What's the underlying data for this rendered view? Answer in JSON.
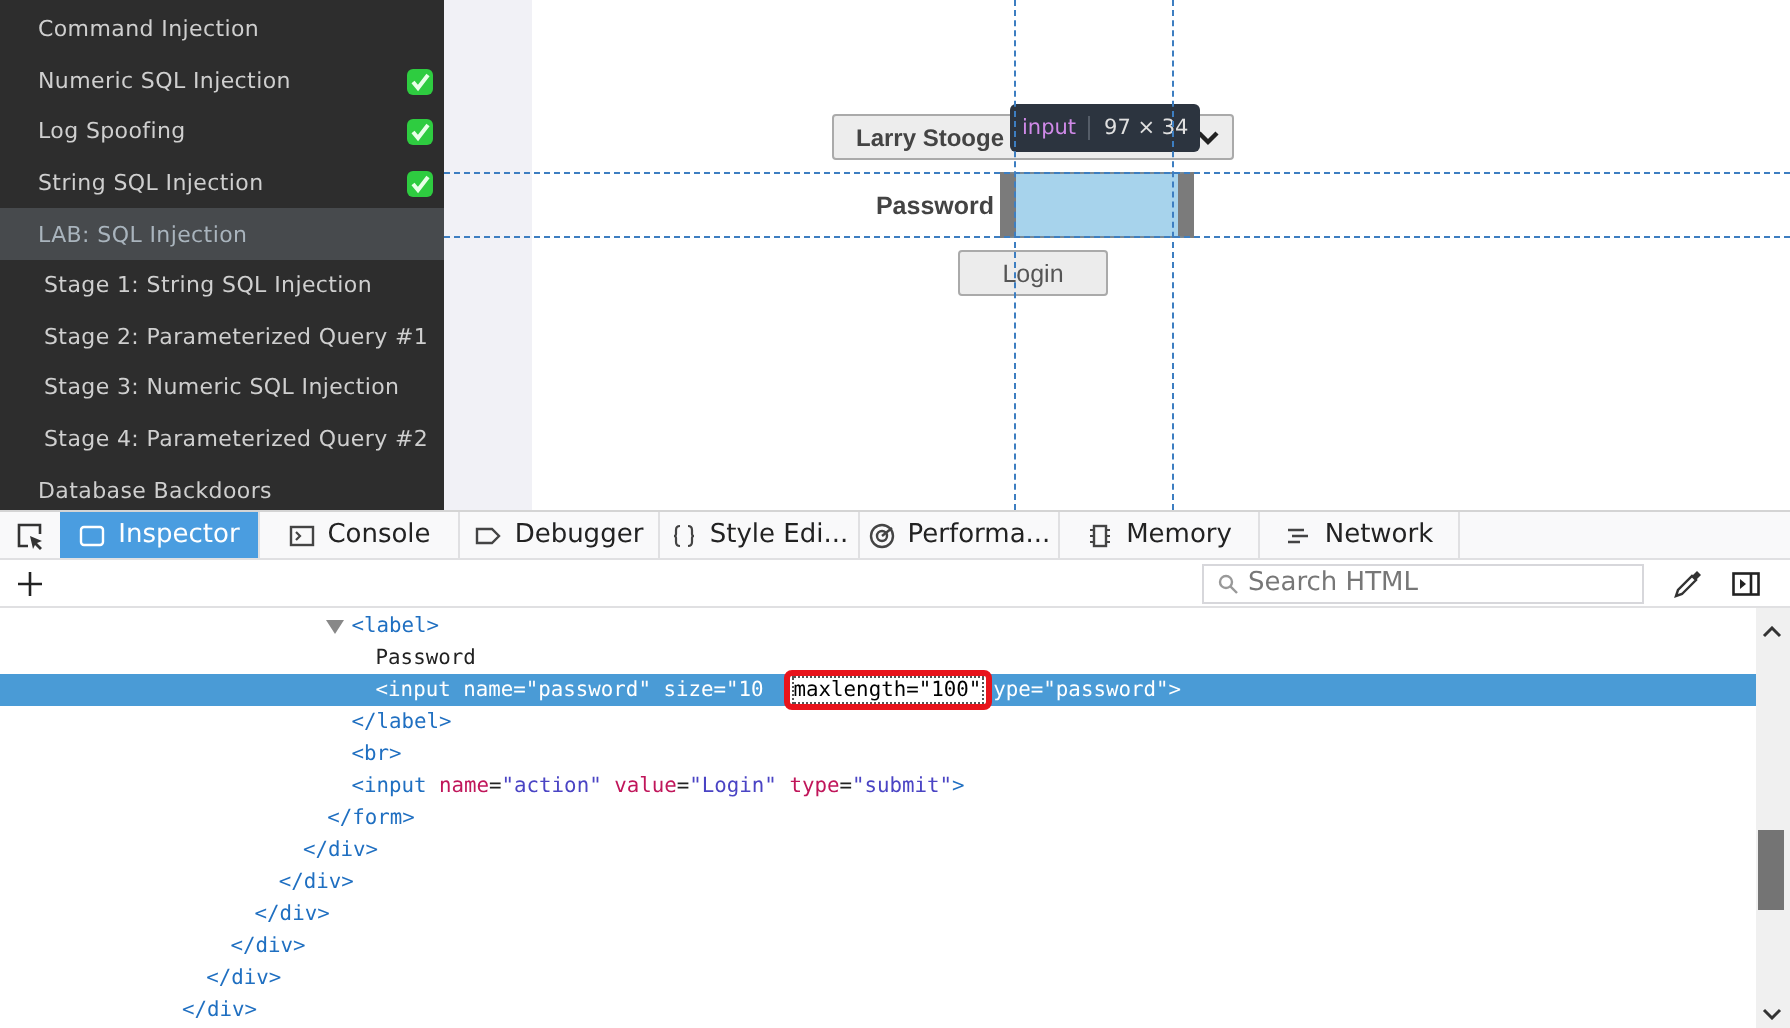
{
  "sidebar": {
    "items": [
      {
        "label": "Command Injection",
        "completed": false,
        "selected": false
      },
      {
        "label": "Numeric SQL Injection",
        "completed": true,
        "selected": false
      },
      {
        "label": "Log Spoofing",
        "completed": true,
        "selected": false
      },
      {
        "label": "String SQL Injection",
        "completed": true,
        "selected": false
      },
      {
        "label": "LAB: SQL Injection",
        "completed": false,
        "selected": true,
        "children": [
          {
            "label": "Stage 1: String SQL Injection",
            "completed": false,
            "selected": false
          },
          {
            "label": "Stage 2: Parameterized Query #1",
            "completed": false,
            "selected": false
          },
          {
            "label": "Stage 3: Numeric SQL Injection",
            "completed": false,
            "selected": false
          },
          {
            "label": "Stage 4: Parameterized Query #2",
            "completed": false,
            "selected": false
          }
        ]
      },
      {
        "label": "Database Backdoors",
        "completed": false,
        "selected": false
      }
    ]
  },
  "page": {
    "user_select": {
      "value": "Larry Stooge"
    },
    "password_label": "Password",
    "password_input": {
      "highlighted": true
    },
    "login_button": "Login",
    "highlighter_tooltip": {
      "tag": "input",
      "size": "97 × 34"
    }
  },
  "devtools": {
    "tabs": [
      {
        "label": "Inspector",
        "selected": true
      },
      {
        "label": "Console",
        "selected": false
      },
      {
        "label": "Debugger",
        "selected": false
      },
      {
        "label": "Style Edi...",
        "selected": false
      },
      {
        "label": "Performa...",
        "selected": false
      },
      {
        "label": "Memory",
        "selected": false
      },
      {
        "label": "Network",
        "selected": false
      }
    ],
    "search": {
      "placeholder": "Search HTML"
    },
    "markup": {
      "nodes": [
        {
          "selected": false,
          "close": [
            {
              "kind": "tag",
              "text": "</div>"
            }
          ],
          "children": [
            {
              "selected": false,
              "close": [
                {
                  "kind": "tag",
                  "text": "</div>"
                }
              ],
              "children": [
                {
                  "selected": false,
                  "close": [
                    {
                      "kind": "tag",
                      "text": "</div>"
                    }
                  ],
                  "children": [
                    {
                      "selected": false,
                      "close": [
                        {
                          "kind": "tag",
                          "text": "</div>"
                        }
                      ],
                      "children": [
                        {
                          "selected": false,
                          "close": [
                            {
                              "kind": "tag",
                              "text": "</div>"
                            }
                          ],
                          "children": [
                            {
                              "selected": false,
                              "close": [
                                {
                                  "kind": "tag",
                                  "text": "</div>"
                                }
                              ],
                              "children": [
                                {
                                  "selected": false,
                                  "close": [
                                    {
                                      "kind": "tag",
                                      "text": "</form>"
                                    }
                                  ],
                                  "children": [
                                    {
                                      "selected": false,
                                      "expanded": true,
                                      "open": [
                                        {
                                          "kind": "tag",
                                          "text": "<label>"
                                        }
                                      ],
                                      "close": [
                                        {
                                          "kind": "tag",
                                          "text": "</label>"
                                        }
                                      ],
                                      "children": [
                                        {
                                          "selected": false,
                                          "open": [
                                            {
                                              "kind": "text",
                                              "text": "Password"
                                            }
                                          ]
                                        },
                                        {
                                          "selected": true,
                                          "open": [
                                            {
                                              "kind": "tag",
                                              "text": "<input"
                                            },
                                            {
                                              "kind": "attr",
                                              "text": " name"
                                            },
                                            {
                                              "kind": "punct",
                                              "text": "="
                                            },
                                            {
                                              "kind": "value",
                                              "text": "\"password\""
                                            },
                                            {
                                              "kind": "attr",
                                              "text": " size"
                                            },
                                            {
                                              "kind": "punct",
                                              "text": "="
                                            },
                                            {
                                              "kind": "value",
                                              "text": "\"10"
                                            },
                                            {
                                              "kind": "editor",
                                              "text": "maxlength=\"100\""
                                            },
                                            {
                                              "kind": "attr",
                                              "text": "ype"
                                            },
                                            {
                                              "kind": "punct",
                                              "text": "="
                                            },
                                            {
                                              "kind": "value",
                                              "text": "\"password\""
                                            },
                                            {
                                              "kind": "tag",
                                              "text": ">"
                                            }
                                          ]
                                        }
                                      ]
                                    },
                                    {
                                      "selected": false,
                                      "open": [
                                        {
                                          "kind": "tag",
                                          "text": "<br>"
                                        }
                                      ]
                                    },
                                    {
                                      "selected": false,
                                      "open": [
                                        {
                                          "kind": "tag",
                                          "text": "<input"
                                        },
                                        {
                                          "kind": "attr",
                                          "text": " name"
                                        },
                                        {
                                          "kind": "punct",
                                          "text": "="
                                        },
                                        {
                                          "kind": "value",
                                          "text": "\"action\""
                                        },
                                        {
                                          "kind": "attr",
                                          "text": " value"
                                        },
                                        {
                                          "kind": "punct",
                                          "text": "="
                                        },
                                        {
                                          "kind": "value",
                                          "text": "\"Login\""
                                        },
                                        {
                                          "kind": "attr",
                                          "text": " type"
                                        },
                                        {
                                          "kind": "punct",
                                          "text": "="
                                        },
                                        {
                                          "kind": "value",
                                          "text": "\"submit\""
                                        },
                                        {
                                          "kind": "tag",
                                          "text": ">"
                                        }
                                      ]
                                    }
                                  ]
                                }
                              ]
                            }
                          ]
                        }
                      ]
                    }
                  ]
                }
              ]
            }
          ]
        }
      ]
    }
  }
}
